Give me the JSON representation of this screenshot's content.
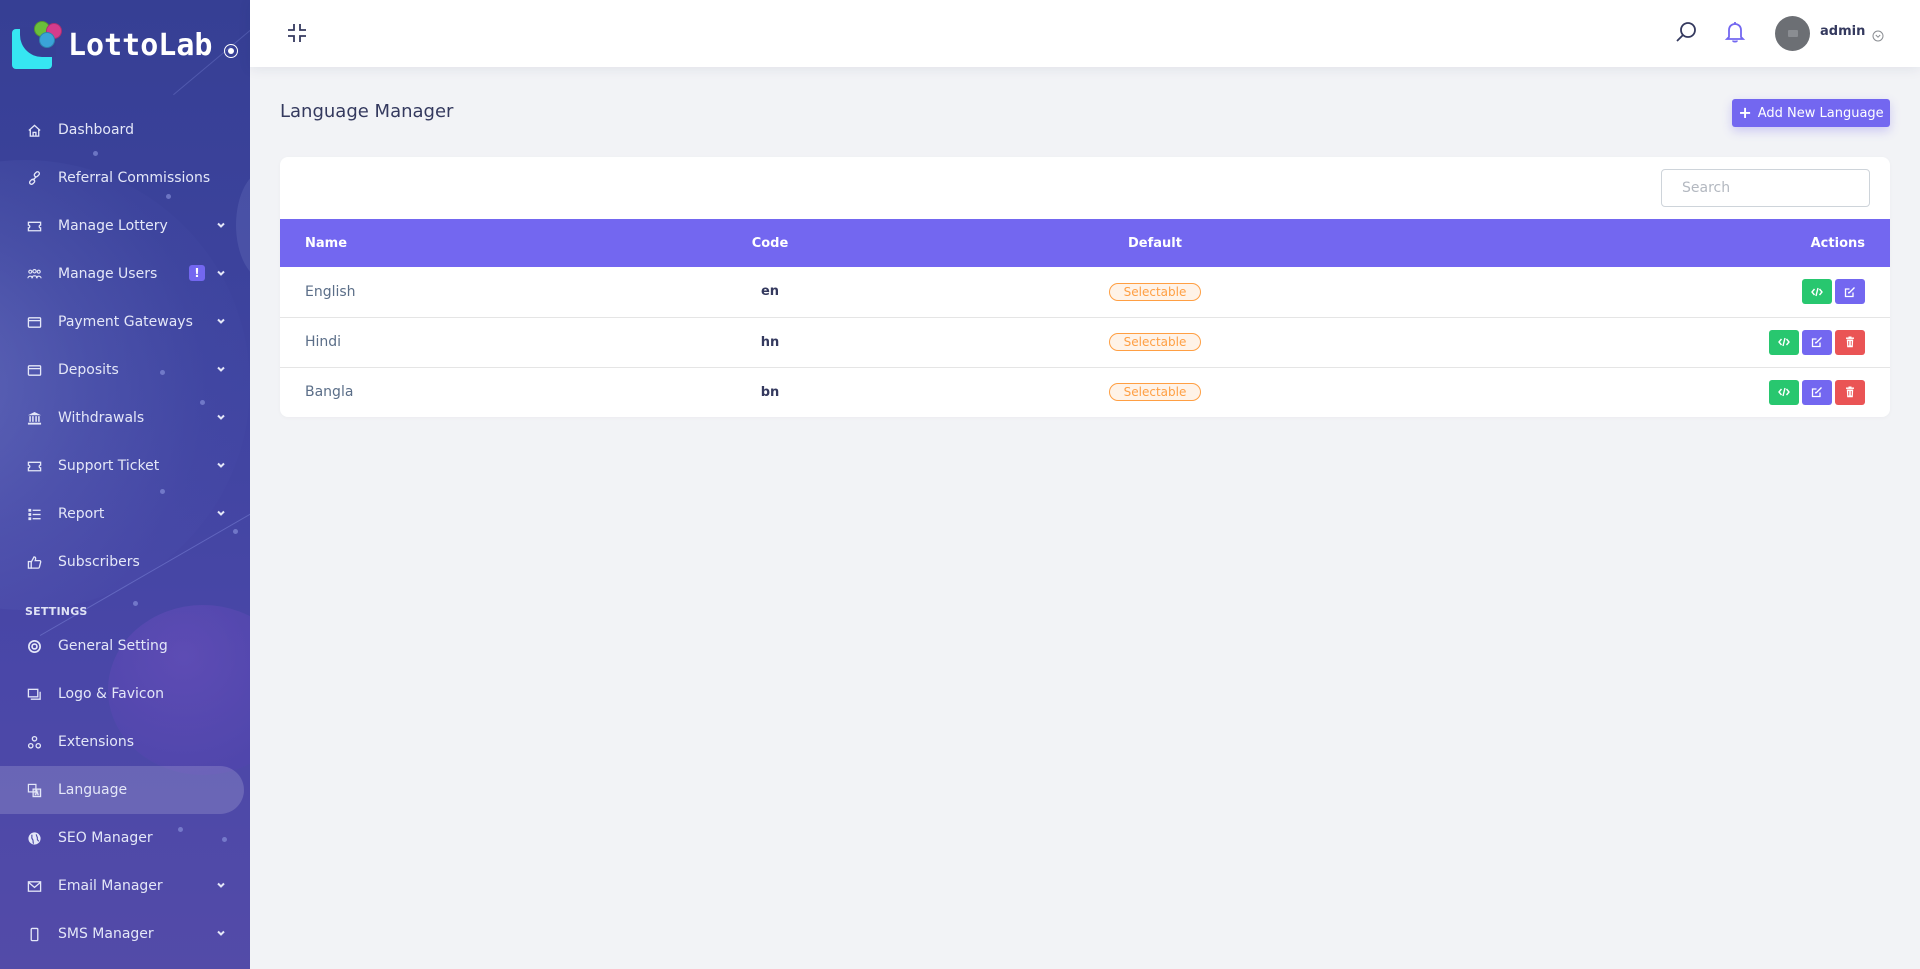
{
  "brand": {
    "name": "LottoLab"
  },
  "sidebar": {
    "items": [
      {
        "label": "Dashboard",
        "icon": "home-icon",
        "has_caret": false
      },
      {
        "label": "Referral Commissions",
        "icon": "link-icon",
        "has_caret": false
      },
      {
        "label": "Manage Lottery",
        "icon": "ticket-icon",
        "has_caret": true
      },
      {
        "label": "Manage Users",
        "icon": "users-icon",
        "has_caret": true,
        "badge": "!"
      },
      {
        "label": "Payment Gateways",
        "icon": "credit-card-icon",
        "has_caret": true
      },
      {
        "label": "Deposits",
        "icon": "credit-card-icon",
        "has_caret": true
      },
      {
        "label": "Withdrawals",
        "icon": "bank-icon",
        "has_caret": true
      },
      {
        "label": "Support Ticket",
        "icon": "ticket-icon",
        "has_caret": true
      },
      {
        "label": "Report",
        "icon": "list-icon",
        "has_caret": true
      },
      {
        "label": "Subscribers",
        "icon": "thumbs-up-icon",
        "has_caret": false
      }
    ],
    "settings_heading": "SETTINGS",
    "settings_items": [
      {
        "label": "General Setting",
        "icon": "life-ring-icon",
        "has_caret": false
      },
      {
        "label": "Logo & Favicon",
        "icon": "images-icon",
        "has_caret": false
      },
      {
        "label": "Extensions",
        "icon": "cubes-icon",
        "has_caret": false
      },
      {
        "label": "Language",
        "icon": "language-icon",
        "has_caret": false,
        "active": true
      },
      {
        "label": "SEO Manager",
        "icon": "globe-icon",
        "has_caret": false
      },
      {
        "label": "Email Manager",
        "icon": "envelope-icon",
        "has_caret": true
      },
      {
        "label": "SMS Manager",
        "icon": "mobile-icon",
        "has_caret": true
      }
    ]
  },
  "topbar": {
    "username": "admin"
  },
  "page": {
    "title": "Language Manager",
    "add_button_label": "Add New Language",
    "search_placeholder": "Search",
    "search_value": ""
  },
  "table": {
    "headers": {
      "name": "Name",
      "code": "Code",
      "default": "Default",
      "actions": "Actions"
    },
    "rows": [
      {
        "name": "English",
        "code": "en",
        "default": "Selectable",
        "actions": [
          "translate",
          "edit"
        ]
      },
      {
        "name": "Hindi",
        "code": "hn",
        "default": "Selectable",
        "actions": [
          "translate",
          "edit",
          "delete"
        ]
      },
      {
        "name": "Bangla",
        "code": "bn",
        "default": "Selectable",
        "actions": [
          "translate",
          "edit",
          "delete"
        ]
      }
    ]
  },
  "colors": {
    "primary": "#7367f0",
    "success": "#28c76f",
    "danger": "#ea5455",
    "warning": "#ff9f43",
    "sidebar": "#3b40a0"
  }
}
